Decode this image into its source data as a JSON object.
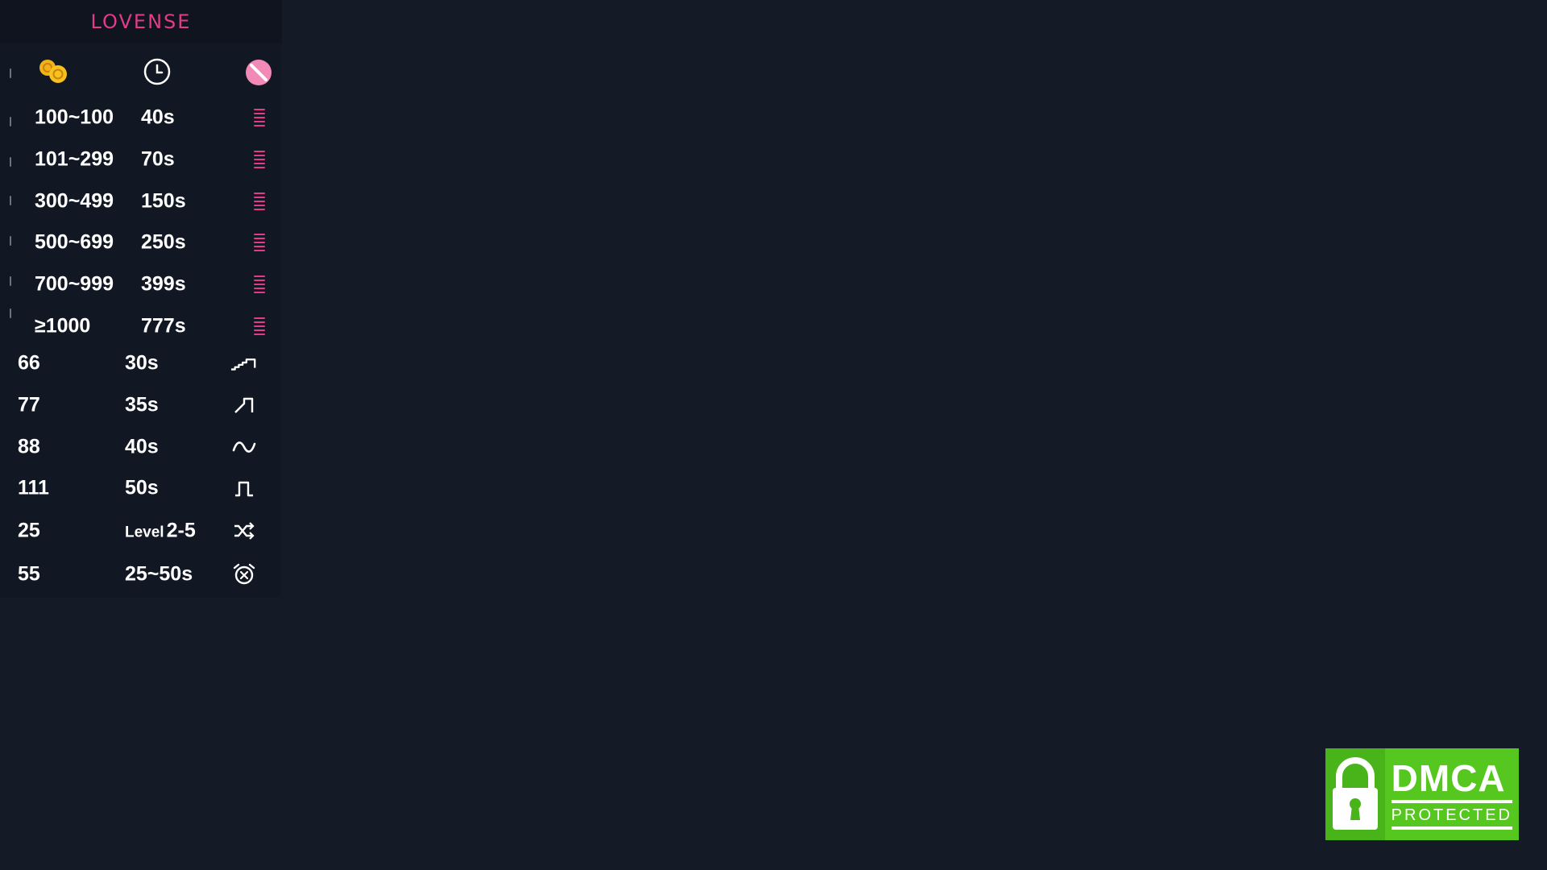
{
  "panel": {
    "logo": "LOVENSE",
    "header": {
      "tokens_icon": "coins-icon",
      "time_icon": "clock-icon",
      "disable_icon": "no-entry-icon"
    },
    "tiers": [
      {
        "range": "100~100",
        "duration": "40s",
        "icon": "menu-lines-icon"
      },
      {
        "range": "101~299",
        "duration": "70s",
        "icon": "menu-lines-icon"
      },
      {
        "range": "300~499",
        "duration": "150s",
        "icon": "menu-lines-icon"
      },
      {
        "range": "500~699",
        "duration": "250s",
        "icon": "menu-lines-icon"
      },
      {
        "range": "700~999",
        "duration": "399s",
        "icon": "menu-lines-icon"
      },
      {
        "range": "≥1000",
        "duration": "777s",
        "icon": "menu-lines-icon"
      }
    ],
    "specials": [
      {
        "tokens": "66",
        "duration": "30s",
        "icon": "staircase-pattern-icon"
      },
      {
        "tokens": "77",
        "duration": "35s",
        "icon": "ramp-pattern-icon"
      },
      {
        "tokens": "88",
        "duration": "40s",
        "icon": "wave-pattern-icon"
      },
      {
        "tokens": "111",
        "duration": "50s",
        "icon": "pulse-pattern-icon"
      },
      {
        "tokens": "25",
        "level_word": "Level",
        "duration": "2-5",
        "icon": "shuffle-icon"
      },
      {
        "tokens": "55",
        "duration": "25~50s",
        "icon": "alarm-clock-icon"
      }
    ]
  },
  "dmca": {
    "title": "DMCA",
    "subtitle": "PROTECTED",
    "icon": "padlock-icon",
    "color": "#55c71f"
  },
  "colors": {
    "background": "#141a26",
    "panel": "#111723",
    "accent": "#e23b8a"
  }
}
